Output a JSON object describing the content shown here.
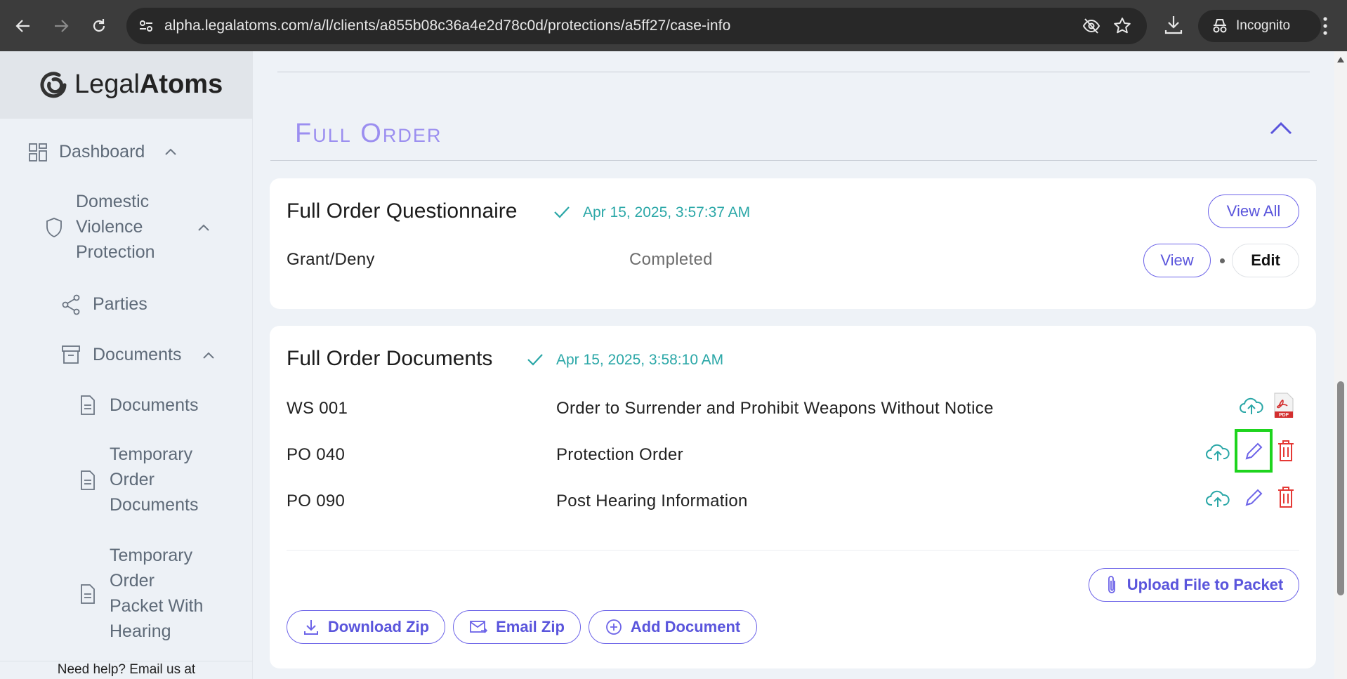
{
  "browser": {
    "url": "alpha.legalatoms.com/a/l/clients/a855b08c36a4e2d78c0d/protections/a5ff27/case-info",
    "incognito_label": "Incognito"
  },
  "sidebar": {
    "logo_light": "Legal",
    "logo_bold": "Atoms",
    "items": [
      {
        "label": "Dashboard"
      },
      {
        "label_lines": [
          "Domestic",
          "Violence",
          "Protection"
        ]
      },
      {
        "label": "Parties"
      },
      {
        "label": "Documents"
      },
      {
        "label": "Documents"
      },
      {
        "label_lines": [
          "Temporary",
          "Order",
          "Documents"
        ]
      },
      {
        "label_lines": [
          "Temporary",
          "Order",
          "Packet With",
          "Hearing"
        ]
      }
    ],
    "help_text": "Need help? Email us at"
  },
  "section": {
    "title": "Full Order"
  },
  "questionnaire": {
    "title": "Full Order Questionnaire",
    "timestamp": "Apr 15, 2025, 3:57:37 AM",
    "view_all_label": "View All",
    "row": {
      "name": "Grant/Deny",
      "status": "Completed",
      "view_label": "View",
      "edit_label": "Edit"
    }
  },
  "documents": {
    "title": "Full Order Documents",
    "timestamp": "Apr 15, 2025, 3:58:10 AM",
    "rows": [
      {
        "code": "WS 001",
        "name": "Order to Surrender and Prohibit Weapons Without Notice"
      },
      {
        "code": "PO 040",
        "name": "Protection Order"
      },
      {
        "code": "PO 090",
        "name": "Post Hearing Information"
      }
    ],
    "upload_label": "Upload File to Packet",
    "download_zip_label": "Download Zip",
    "email_zip_label": "Email Zip",
    "add_document_label": "Add Document"
  },
  "colors": {
    "accent": "#6c63e8",
    "teal": "#2aa7a7",
    "danger": "#e53935",
    "highlight": "#1ed41e"
  }
}
